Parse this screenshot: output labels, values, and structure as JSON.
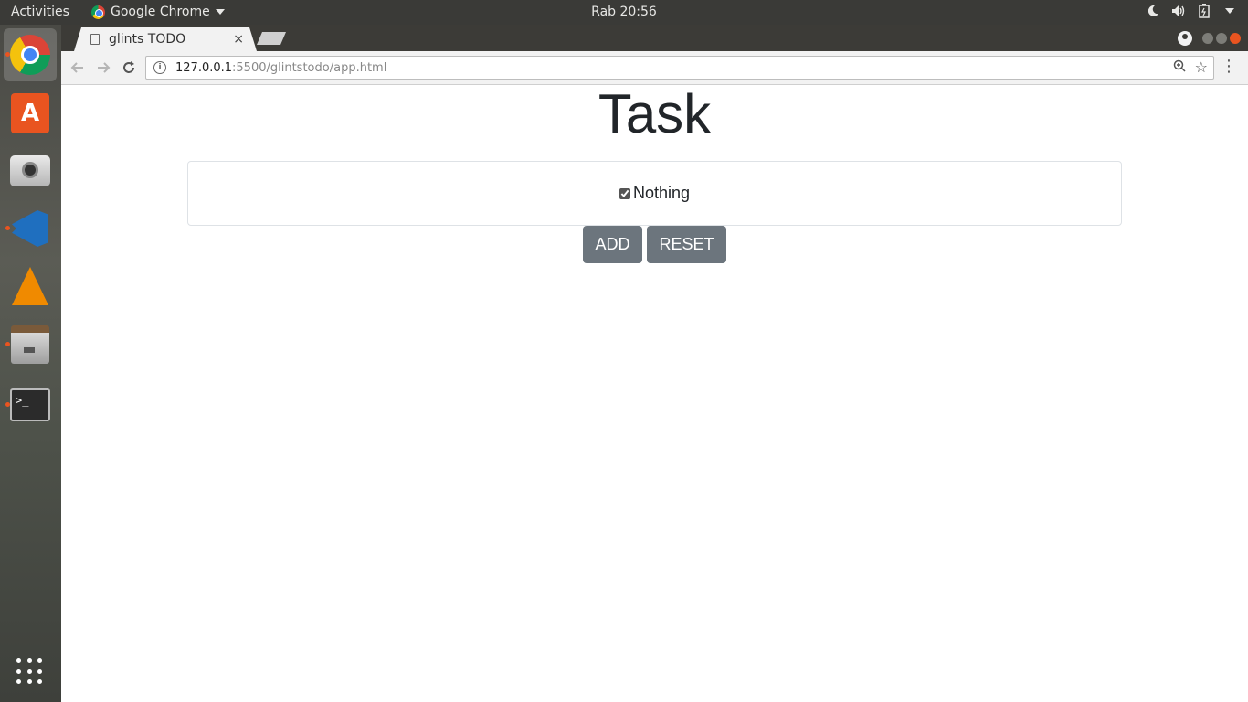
{
  "topbar": {
    "activities": "Activities",
    "app_name": "Google Chrome",
    "clock": "Rab 20:56",
    "tray_icons": [
      "night-light-icon",
      "volume-icon",
      "battery-icon",
      "system-menu-caret-icon"
    ]
  },
  "dock": {
    "items": [
      {
        "name": "chrome",
        "active": true,
        "running": true
      },
      {
        "name": "ubuntu-software",
        "running": false
      },
      {
        "name": "screenshot-camera",
        "running": false
      },
      {
        "name": "vscode",
        "running": true
      },
      {
        "name": "vlc",
        "running": false
      },
      {
        "name": "files",
        "running": true
      },
      {
        "name": "terminal",
        "running": true
      }
    ],
    "show_apps_icon": "grid-icon"
  },
  "browser": {
    "tab_title": "glints TODO",
    "tab_close": "×",
    "url_host": "127.0.0.1",
    "url_path": ":5500/glintstodo/app.html",
    "accent": "#e95420"
  },
  "page": {
    "title": "Task",
    "tasks": [
      {
        "label": "Nothing",
        "checked": true
      }
    ],
    "add_label": "ADD",
    "reset_label": "RESET",
    "button_color": "#6c757d"
  }
}
